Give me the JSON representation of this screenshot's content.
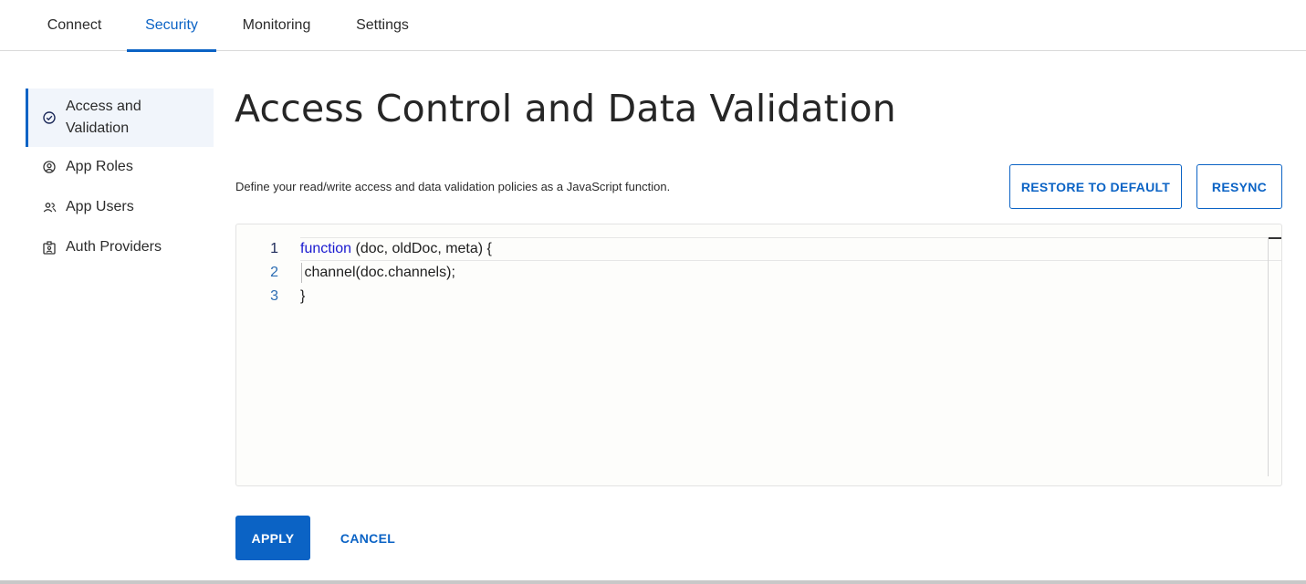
{
  "tabs": [
    {
      "label": "Connect",
      "active": false
    },
    {
      "label": "Security",
      "active": true
    },
    {
      "label": "Monitoring",
      "active": false
    },
    {
      "label": "Settings",
      "active": false
    }
  ],
  "sidebar": {
    "items": [
      {
        "label": "Access and Validation",
        "icon": "check-circle-icon",
        "active": true
      },
      {
        "label": "App Roles",
        "icon": "user-circle-icon",
        "active": false
      },
      {
        "label": "App Users",
        "icon": "users-icon",
        "active": false
      },
      {
        "label": "Auth Providers",
        "icon": "id-badge-icon",
        "active": false
      }
    ]
  },
  "main": {
    "title": "Access Control and Data Validation",
    "description": "Define your read/write access and data validation policies as a JavaScript function.",
    "restore_label": "RESTORE TO DEFAULT",
    "resync_label": "RESYNC",
    "apply_label": "APPLY",
    "cancel_label": "CANCEL"
  },
  "editor": {
    "line_numbers": [
      "1",
      "2",
      "3"
    ],
    "line1_keyword": "function",
    "line1_rest": " (doc, oldDoc, meta) {",
    "line2": " channel(doc.channels);",
    "line3": "}"
  },
  "colors": {
    "accent": "#0b63c5",
    "keyword": "#1a1ad0",
    "line_number": "#2b6cb3"
  }
}
